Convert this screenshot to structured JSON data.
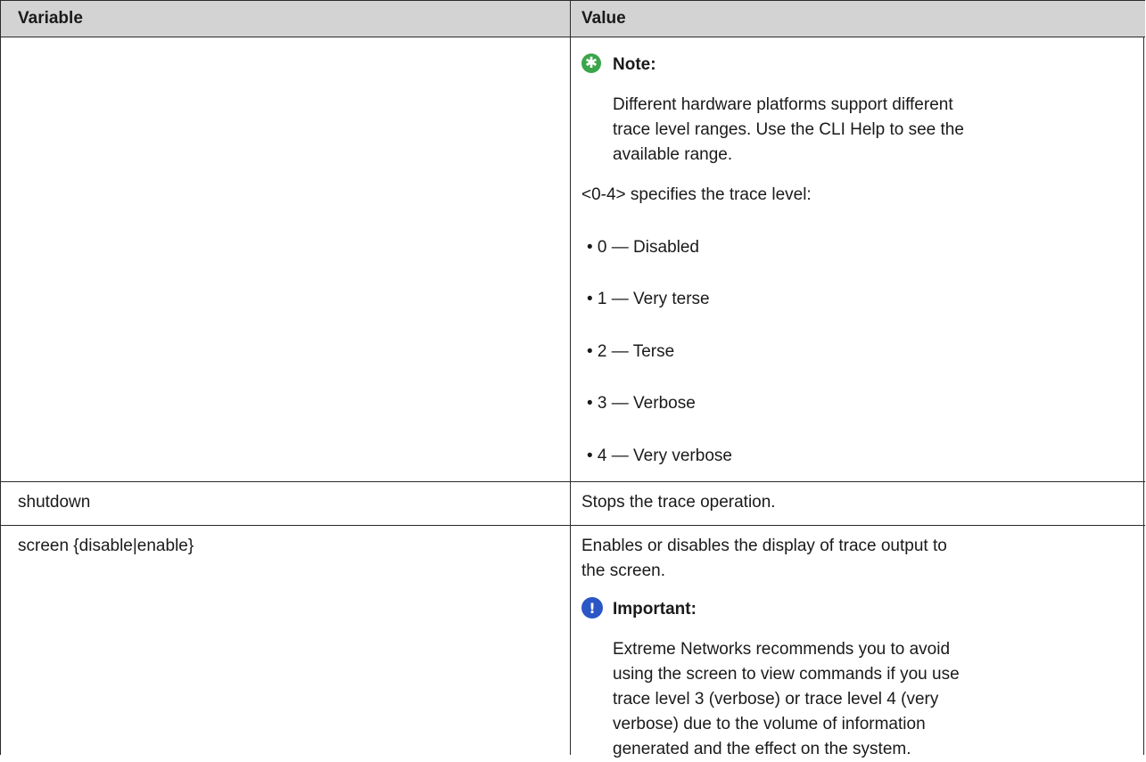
{
  "table": {
    "headers": [
      "Variable",
      "Value"
    ],
    "row1": {
      "variable": "",
      "note_title": "Note:",
      "note_lines": [
        "Different hardware platforms support different",
        "trace level ranges. Use the CLI Help to see the",
        "available range."
      ],
      "intro": "<0-4> specifies the trace level:",
      "levels": [
        "• 0 — Disabled",
        "• 1 — Very terse",
        "• 2 — Terse",
        "• 3 — Verbose",
        "• 4 — Very verbose"
      ]
    },
    "row2": {
      "variable": "shutdown",
      "value": "Stops the trace operation."
    },
    "row3": {
      "variable": "screen {disable|enable}",
      "value_lines": [
        "Enables or disables the display of trace output to",
        "the screen."
      ],
      "important_title": "Important:",
      "important_lines": [
        "Extreme Networks recommends you to avoid",
        "using the screen to view commands if you use",
        "trace level 3 (verbose) or trace level 4 (very",
        "verbose) due to the volume of information",
        "generated and the effect on the system."
      ]
    }
  },
  "icons": {
    "note": "star-icon",
    "important": "exclamation-icon"
  },
  "colors": {
    "header_bg": "#d3d3d3",
    "note_green": "#3aa54a",
    "important_blue": "#2a56c6"
  }
}
